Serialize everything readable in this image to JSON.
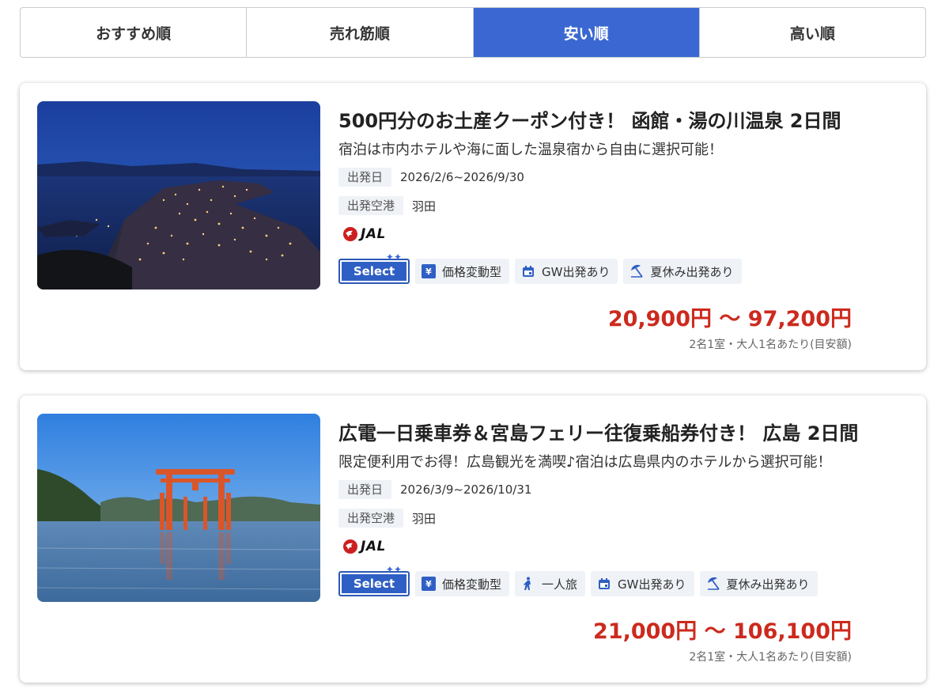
{
  "sort_tabs": {
    "items": [
      {
        "label": "おすすめ順"
      },
      {
        "label": "売れ筋順"
      },
      {
        "label": "安い順"
      },
      {
        "label": "高い順"
      }
    ],
    "active": "安い順",
    "active_color": "#3a67d1"
  },
  "tours": [
    {
      "title": "500円分のお土産クーポン付き！ 函館・湯の川温泉 2日間",
      "subtitle": "宿泊は市内ホテルや海に面した温泉宿から自由に選択可能！",
      "departure_date_label": "出発日",
      "departure_date": "2026/2/6~2026/9/30",
      "departure_airport_label": "出発空港",
      "departure_airport": "羽田",
      "airline": "JAL",
      "select_badge": "Select",
      "tags": [
        {
          "icon": "yen-icon",
          "label": "価格変動型"
        },
        {
          "icon": "calendar-icon",
          "label": "GW出発あり"
        },
        {
          "icon": "parasol-icon",
          "label": "夏休み出発あり"
        }
      ],
      "price": "20,900円 〜 97,200円",
      "price_note": "2名1室・大人1名あたり(目安額)",
      "image": "hakodate-night-view"
    },
    {
      "title": "広電一日乗車券＆宮島フェリー往復乗船券付き！ 広島 2日間",
      "subtitle": "限定便利用でお得！広島観光を満喫♪宿泊は広島県内のホテルから選択可能！",
      "departure_date_label": "出発日",
      "departure_date": "2026/3/9~2026/10/31",
      "departure_airport_label": "出発空港",
      "departure_airport": "羽田",
      "airline": "JAL",
      "select_badge": "Select",
      "tags": [
        {
          "icon": "yen-icon",
          "label": "価格変動型"
        },
        {
          "icon": "walking-person-icon",
          "label": "一人旅"
        },
        {
          "icon": "calendar-icon",
          "label": "GW出発あり"
        },
        {
          "icon": "parasol-icon",
          "label": "夏休み出発あり"
        }
      ],
      "price": "21,000円 〜 106,100円",
      "price_note": "2名1室・大人1名あたり(目安額)",
      "image": "miyajima-torii"
    }
  ],
  "colors": {
    "accent": "#3a67d1",
    "price": "#cc2a1e",
    "tag_bg": "#eff2f7"
  }
}
